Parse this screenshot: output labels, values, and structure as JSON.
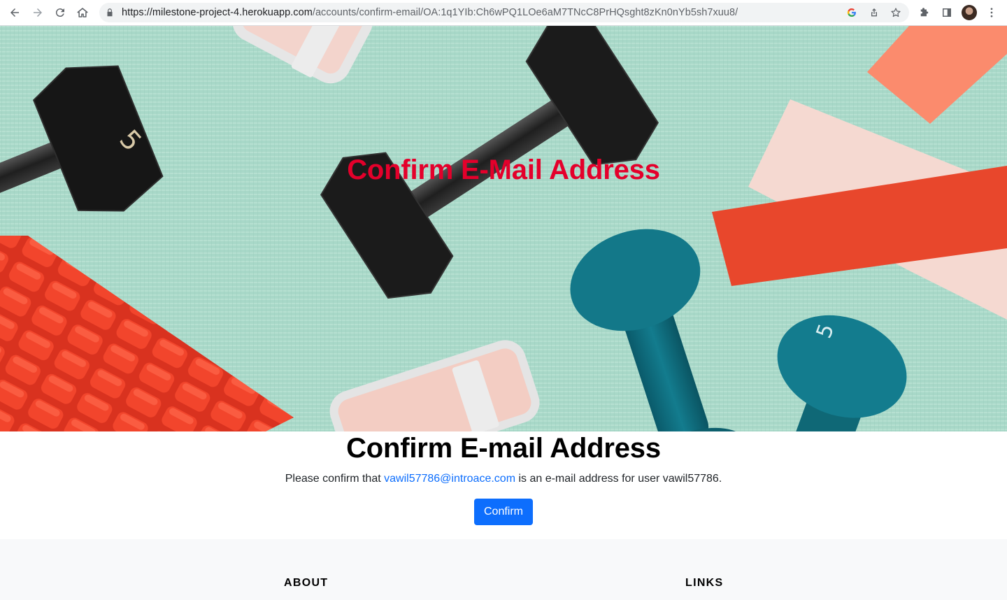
{
  "browser": {
    "url_host": "https://milestone-project-4.herokuapp.com",
    "url_path": "/accounts/confirm-email/OA:1q1YIb:Ch6wPQ1LOe6aM7TNcC8PrHQsght8zKn0nYb5sh7xuu8/",
    "icons": [
      "back-icon",
      "forward-icon",
      "reload-icon",
      "home-icon",
      "lock-icon",
      "google-icon",
      "share-icon",
      "star-icon",
      "extensions-icon",
      "sidebar-icon",
      "avatar",
      "menu-icon"
    ]
  },
  "hero": {
    "title": "Confirm E-Mail Address",
    "title_color": "#e4002b"
  },
  "main": {
    "title": "Confirm E-mail Address",
    "text_before": "Please confirm that ",
    "email": "vawil57786@introace.com",
    "text_after": " is an e-mail address for user vawil57786.",
    "confirm_button": "Confirm",
    "accent_color": "#0d6efd"
  },
  "footer": {
    "about_heading": "ABOUT",
    "links_heading": "LINKS"
  }
}
